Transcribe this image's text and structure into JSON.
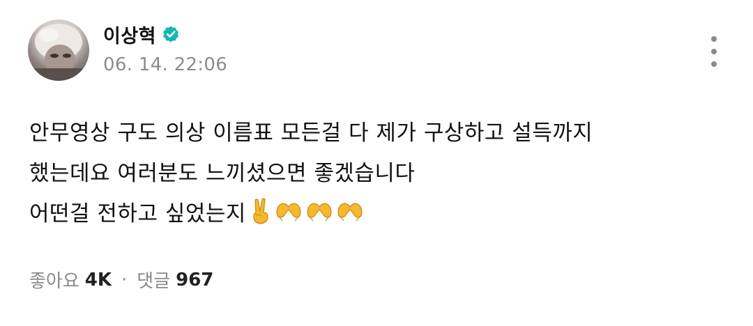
{
  "post": {
    "author": {
      "name": "이상혁",
      "verified_icon": "verified-badge-icon",
      "avatar_icon": "profile-avatar"
    },
    "timestamp": "06. 14. 22:06",
    "menu_icon": "more-vertical-icon",
    "body_lines": [
      "안무영상 구도 의상 이름표 모든걸 다 제가 구상하고 설득까지",
      "했는데요 여러분도 느끼셨으면 좋겠습니다",
      "어떤걸 전하고 싶었는지"
    ],
    "emojis": [
      "✌️",
      "🫶",
      "🫶",
      "🫶"
    ],
    "stats": {
      "likes_label": "좋아요",
      "likes_count": "4K",
      "separator": "·",
      "comments_label": "댓글",
      "comments_count": "967"
    },
    "colors": {
      "verified": "#12b8b0",
      "text": "#111111",
      "muted": "#8c8c8c",
      "emoji": "#f5b82e"
    }
  }
}
